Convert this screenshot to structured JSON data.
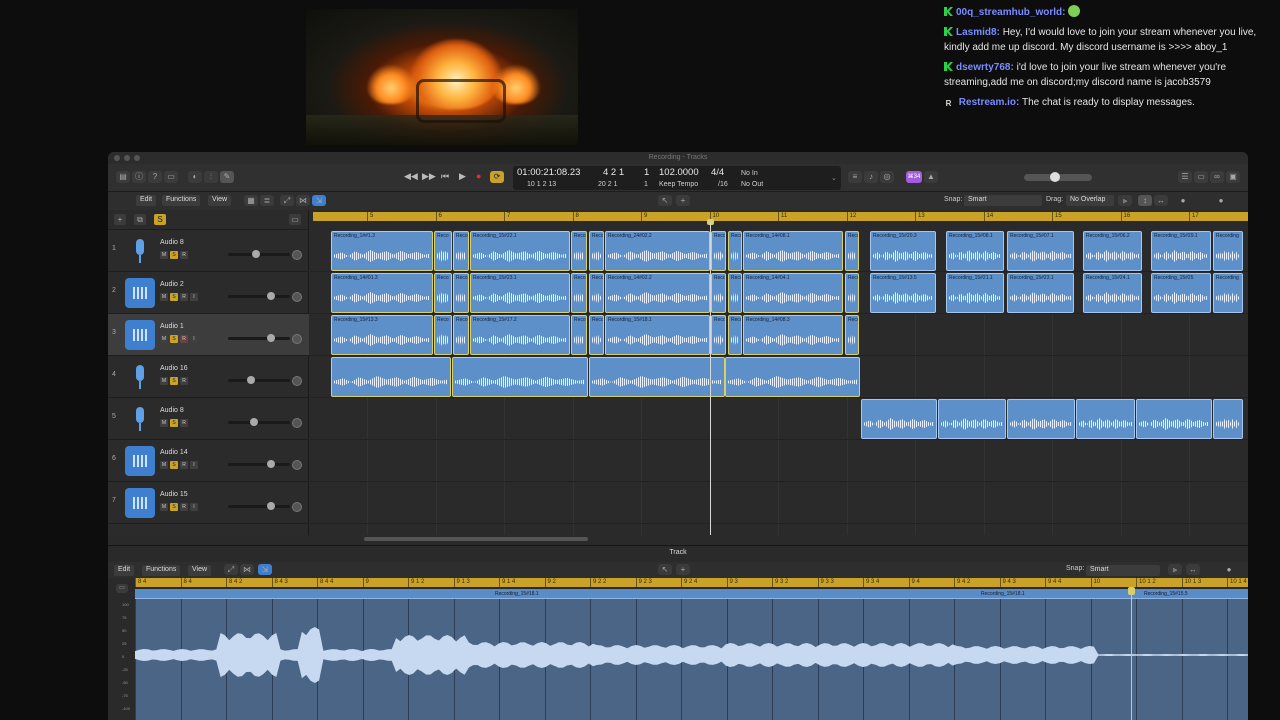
{
  "chat": {
    "messages": [
      {
        "user": "00q_streamhub_world:",
        "text": "",
        "badge": "kick"
      },
      {
        "user": "Lasmid8:",
        "text": "Hey, I'd would love to join your stream whenever you live, kindly add me up discord. My discord username is >>>> aboy_1",
        "badge": "kick"
      },
      {
        "user": "dsewrty768:",
        "text": "i'd love to join your live stream whenever you're streaming,add me on discord;my discord name is jacob3579",
        "badge": "kick"
      },
      {
        "user": "Restream.io:",
        "text": "The chat is ready to display messages.",
        "badge": "R"
      }
    ]
  },
  "window": {
    "title": "Recording - Tracks"
  },
  "lcd": {
    "time": "01:00:21:08.23",
    "bars_top": "4  2  1",
    "bars_top_beat": "1",
    "bars_sub": "10  1  2  13",
    "bars_sub2": "20  2  1",
    "bars_sub_beat": "1",
    "tempo": "102.0000",
    "tempo_mode": "Keep Tempo",
    "sig": "4/4",
    "div": "/16",
    "in": "No In",
    "out": "No Out"
  },
  "toolbar": {
    "purple_badge": "⌘34"
  },
  "menus": {
    "edit": "Edit",
    "functions": "Functions",
    "view": "View",
    "snap_label": "Snap:",
    "snap_value": "Smart",
    "drag_label": "Drag:",
    "drag_value": "No Overlap"
  },
  "ruler": [
    "5",
    "6",
    "7",
    "8",
    "9",
    "10",
    "11",
    "12",
    "13",
    "14",
    "15",
    "16",
    "17"
  ],
  "tracks": [
    {
      "num": "1",
      "name": "Audio 8",
      "icon": "mic",
      "fader": 0.45
    },
    {
      "num": "2",
      "name": "Audio 2",
      "icon": "wave",
      "fader": 0.72
    },
    {
      "num": "3",
      "name": "Audio 1",
      "icon": "wave",
      "fader": 0.72
    },
    {
      "num": "4",
      "name": "Audio 16",
      "icon": "mic",
      "fader": 0.35
    },
    {
      "num": "5",
      "name": "Audio 8",
      "icon": "mic",
      "fader": 0.4
    },
    {
      "num": "6",
      "name": "Audio 14",
      "icon": "wave",
      "fader": 0.72
    },
    {
      "num": "7",
      "name": "Audio 15",
      "icon": "wave",
      "fader": 0.72
    }
  ],
  "regions": {
    "lane1": [
      "Recording_1##1.3",
      "Reco",
      "Reco",
      "Recording_15#22.1",
      "Reco",
      "Reco",
      "Recording_24#02.2",
      "Reco",
      "Reco",
      "Recording_14#08.1",
      "Reco",
      "Recording_15#20.3",
      "Recording_15#08.1",
      "Recording_15#07.1",
      "Recording_15#06.2",
      "Recording_15#29.1",
      "Recording"
    ],
    "lane2": [
      "Recording_14#01.3",
      "Reco",
      "Reco",
      "Recording_15#23.1",
      "Reco",
      "Reco",
      "Recording_14#02.2",
      "Reco",
      "Reco",
      "Recording_14#04.1",
      "Reco",
      "Recording_15#13.5",
      "Recording_15#21.1",
      "Recording_15#23.1",
      "Recording_15#24.1",
      "Recording_15#25",
      "Recording"
    ],
    "lane3": [
      "Recording_15#13.3",
      "Reco",
      "Reco",
      "Recording_15#17.2",
      "Reco",
      "Reco",
      "Recording_15#18.1",
      "Reco",
      "Reco",
      "Recording_14#08.3",
      "Reco"
    ]
  },
  "editor": {
    "title": "Track",
    "edit": "Edit",
    "functions": "Functions",
    "view": "View",
    "snap_label": "Snap:",
    "snap_value": "Smart",
    "ruler": [
      "8 4",
      "8 4",
      "8 4 2",
      "8 4 3",
      "8 4 4",
      "9",
      "9 1 2",
      "9 1 3",
      "9 1 4",
      "9 2",
      "9 2 2",
      "9 2 3",
      "9 2 4",
      "9 3",
      "9 3 2",
      "9 3 3",
      "9 3 4",
      "9 4",
      "9 4 2",
      "9 4 3",
      "9 4 4",
      "10",
      "10 1 2",
      "10 1 3",
      "10 1 4"
    ],
    "region_names": [
      "Recording_15#18.1",
      "Recording_15#18.1",
      "Recording_15#15.5"
    ],
    "db_labels": [
      "100",
      "75",
      "50",
      "25",
      "0",
      "-25",
      "-50",
      "-75",
      "-100"
    ]
  }
}
